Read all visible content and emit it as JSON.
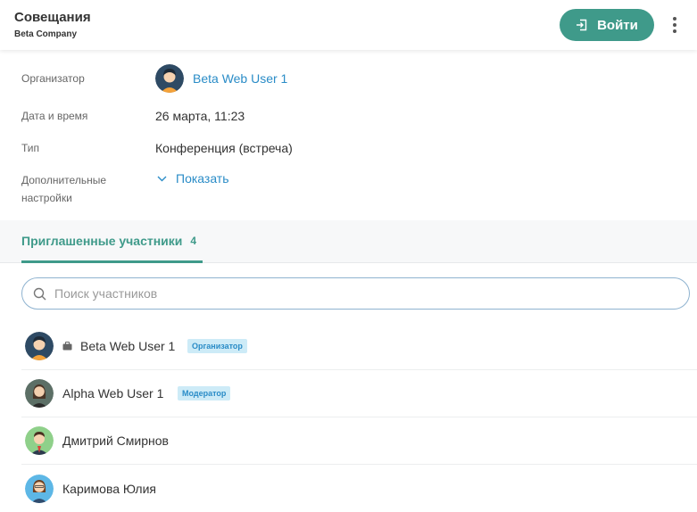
{
  "header": {
    "title": "Совещания",
    "subtitle": "Beta Company",
    "join_label": "Войти"
  },
  "details": {
    "organizer_label": "Организатор",
    "organizer_name": "Beta Web User 1",
    "datetime_label": "Дата и время",
    "datetime_value": "26 марта, 11:23",
    "type_label": "Тип",
    "type_value": "Конференция (встреча)",
    "extra_label_line1": "Дополнительные",
    "extra_label_line2": "настройки",
    "show_label": "Показать"
  },
  "tabs": [
    {
      "label": "Приглашенные участники",
      "count": "4"
    }
  ],
  "search": {
    "placeholder": "Поиск участников"
  },
  "participants": [
    {
      "name": "Beta Web User 1",
      "role": "Организатор"
    },
    {
      "name": "Alpha Web User 1",
      "role": "Модератор"
    },
    {
      "name": "Дмитрий Смирнов",
      "role": ""
    },
    {
      "name": "Каримова Юлия",
      "role": ""
    }
  ],
  "colors": {
    "accent": "#3f9a8a",
    "link": "#2a8cc7",
    "badge_bg": "#cdebf7"
  }
}
